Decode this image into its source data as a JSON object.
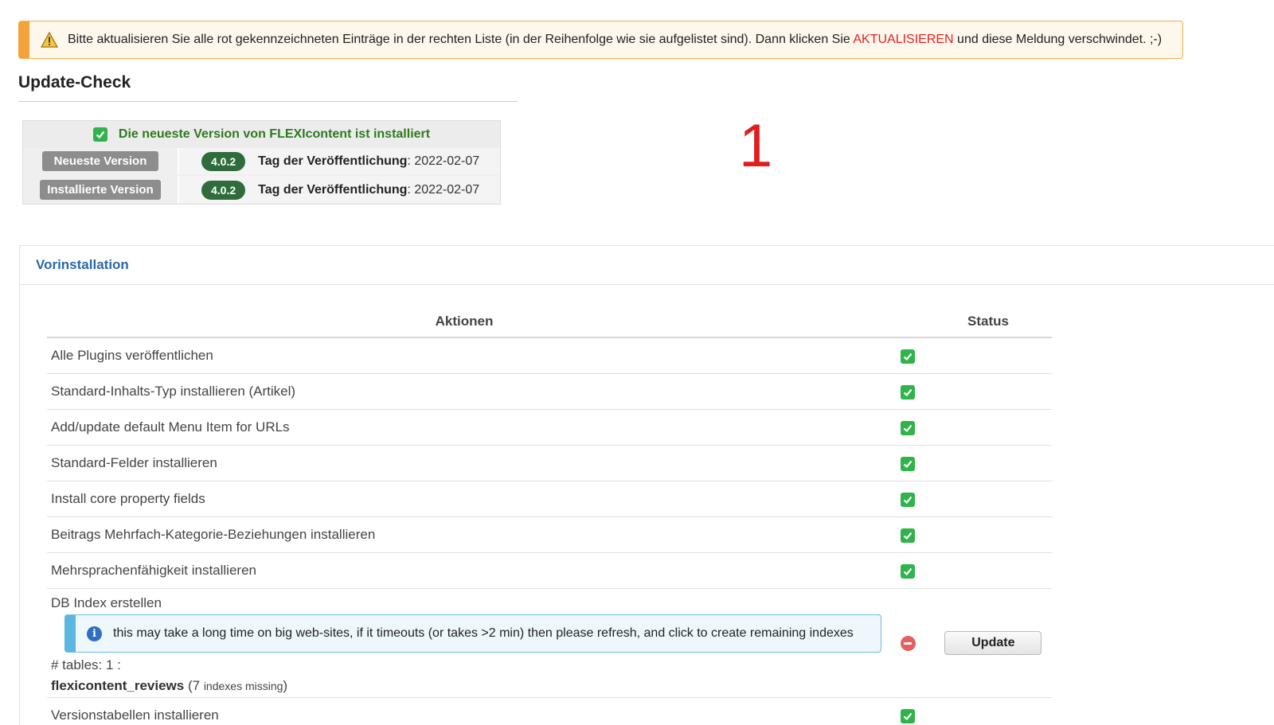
{
  "warning": {
    "text_before": "Bitte aktualisieren Sie alle rot gekennzeichneten Einträge in der rechten Liste (in der Reihenfolge wie sie aufgelistet sind). Dann klicken Sie ",
    "highlight": "AKTUALISIEREN",
    "text_after": " und diese Meldung verschwindet. ;-)"
  },
  "update_check": {
    "title": "Update-Check",
    "status_message": "Die neueste Version von FLEXIcontent ist installiert",
    "rows": [
      {
        "label": "Neueste Version",
        "version": "4.0.2",
        "date_label": "Tag der Veröffentlichung",
        "date": ": 2022-02-07"
      },
      {
        "label": "Installierte Version",
        "version": "4.0.2",
        "date_label": "Tag der Veröffentlichung",
        "date": ": 2022-02-07"
      }
    ]
  },
  "annotation_number": "1",
  "preinstall": {
    "title": "Vorinstallation",
    "col_actions": "Aktionen",
    "col_status": "Status",
    "tasks": [
      {
        "label": "Alle Plugins veröffentlichen",
        "status": "ok"
      },
      {
        "label": "Standard-Inhalts-Typ installieren (Artikel)",
        "status": "ok"
      },
      {
        "label": "Add/update default Menu Item for URLs",
        "status": "ok"
      },
      {
        "label": "Standard-Felder installieren",
        "status": "ok"
      },
      {
        "label": "Install core property fields",
        "status": "ok"
      },
      {
        "label": "Beitrags Mehrfach-Kategorie-Beziehungen installieren",
        "status": "ok"
      },
      {
        "label": "Mehrsprachenfähigkeit installieren",
        "status": "ok"
      }
    ],
    "db_index": {
      "label": "DB Index erstellen",
      "info": "this may take a long time on big web-sites, if it timeouts (or takes >2 min) then please refresh, and click to create remaining indexes",
      "tables_count": "# tables: 1 :",
      "table_name": "flexicontent_reviews",
      "missing_open": " (7 ",
      "missing_text": "indexes missing",
      "missing_close": ")",
      "status": "error",
      "button": "Update"
    },
    "last_task": {
      "label": "Versionstabellen installieren",
      "status": "ok"
    }
  },
  "colors": {
    "warning_border": "#f2a33a",
    "highlight_red": "#e32222",
    "ok_green": "#2fb34a",
    "error_red": "#e56060",
    "link_blue": "#2a68a8",
    "badge_green": "#2f6b3b"
  }
}
